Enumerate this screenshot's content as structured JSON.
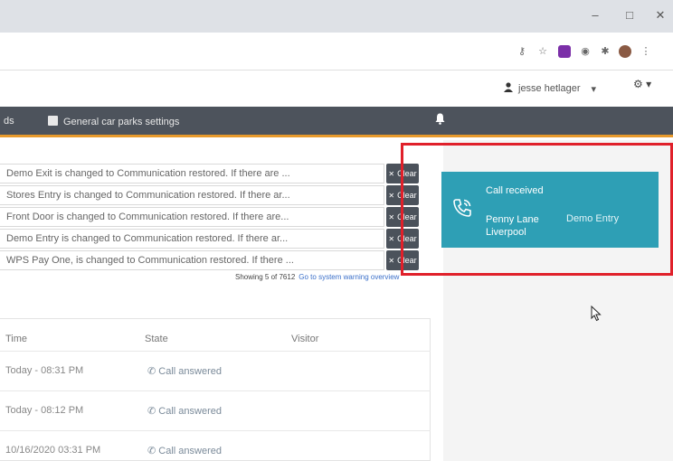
{
  "browser": {
    "minimize_icon": "–",
    "maximize_icon": "□",
    "close_icon": "✕"
  },
  "header": {
    "user_name": "jesse hetlager",
    "user_caret": "▾",
    "settings_caret": "▾"
  },
  "nav": {
    "partial_item": "ds",
    "car_parks_settings": "General car parks settings"
  },
  "warnings": [
    {
      "text": "Demo Exit is changed to Communication restored. If there are ...",
      "action": "Clear"
    },
    {
      "text": "Stores Entry is changed to Communication restored. If there ar...",
      "action": "Clear"
    },
    {
      "text": "Front Door is changed to Communication restored. If there are...",
      "action": "Clear"
    },
    {
      "text": "Demo Entry is changed to Communication restored. If there ar...",
      "action": "Clear"
    },
    {
      "text": "WPS Pay One, is changed to Communication restored. If there ...",
      "action": "Clear"
    }
  ],
  "warnings_footer": {
    "showing": "Showing 5 of 7612",
    "link": "Go to system warning overview"
  },
  "calls": {
    "columns": [
      "Time",
      "State",
      "Visitor"
    ],
    "rows": [
      {
        "time": "Today - 08:31 PM",
        "state": "Call answered",
        "visitor": ""
      },
      {
        "time": "Today - 08:12 PM",
        "state": "Call answered",
        "visitor": ""
      },
      {
        "time": "10/16/2020 03:31 PM",
        "state": "Call answered",
        "visitor": ""
      }
    ]
  },
  "toast": {
    "title": "Call received",
    "site_line1": "Penny Lane",
    "site_line2": "Liverpool",
    "door": "Demo Entry",
    "icon": "phone-ringing-icon",
    "color": "#2e9fb5"
  },
  "highlight_color": "#e0202a"
}
